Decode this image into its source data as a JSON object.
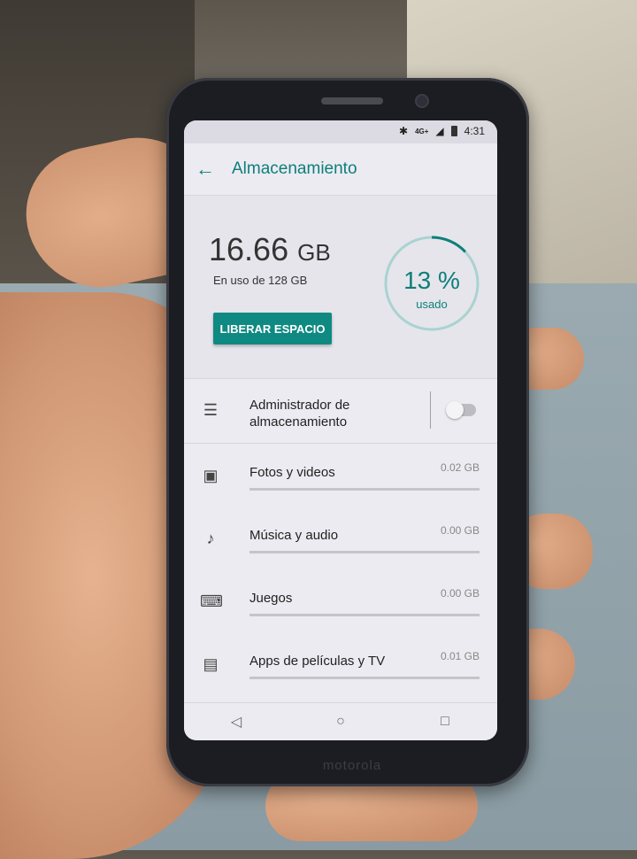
{
  "status_bar": {
    "time": "4:31",
    "network": "4G+",
    "icons": [
      "bluetooth-icon",
      "signal-icon",
      "battery-icon"
    ]
  },
  "app_bar": {
    "title": "Almacenamiento",
    "back_icon": "arrow-left-icon"
  },
  "summary": {
    "used_value": "16.66",
    "used_unit": "GB",
    "used_of": "En uso de 128 GB",
    "free_button": "LIBERAR ESPACIO",
    "percent_text": "13 %",
    "percent_label": "usado",
    "percent_fraction": 0.13
  },
  "manager": {
    "label": "Administrador de almacenamiento",
    "toggle_on": false
  },
  "categories": [
    {
      "label": "Fotos y videos",
      "size": "0.02 GB",
      "icon": "image-icon",
      "fraction": 0.0
    },
    {
      "label": "Música y audio",
      "size": "0.00 GB",
      "icon": "music-icon",
      "fraction": 0.0
    },
    {
      "label": "Juegos",
      "size": "0.00 GB",
      "icon": "gamepad-icon",
      "fraction": 0.0
    },
    {
      "label": "Apps de películas y TV",
      "size": "0.01 GB",
      "icon": "film-icon",
      "fraction": 0.0
    }
  ],
  "brand": "motorola",
  "colors": {
    "accent": "#0d7f7a",
    "button": "#0f8a82",
    "screen_bg": "#ecebf1"
  }
}
